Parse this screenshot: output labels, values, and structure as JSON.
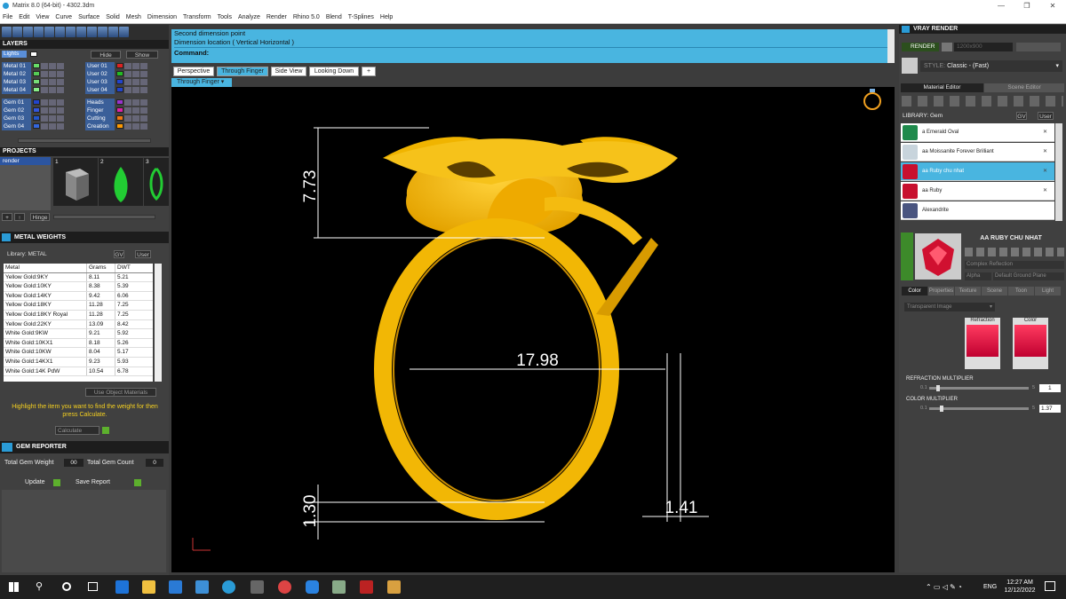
{
  "window": {
    "title": "Matrix 8.0 (64-bit) - 4302.3dm"
  },
  "menu": [
    "File",
    "Edit",
    "View",
    "Curve",
    "Surface",
    "Solid",
    "Mesh",
    "Dimension",
    "Transform",
    "Tools",
    "Analyze",
    "Render",
    "Rhino 5.0",
    "Blend",
    "T-Splines",
    "Help"
  ],
  "layers": {
    "title": "LAYERS",
    "view_mode": "Lights",
    "hide": "Hide",
    "show": "Show",
    "left": [
      {
        "name": "Metal 01",
        "color": "#66dd66"
      },
      {
        "name": "Metal 02",
        "color": "#55cc55"
      },
      {
        "name": "Metal 03",
        "color": "#77dd77"
      },
      {
        "name": "Metal 04",
        "color": "#88ee88"
      },
      {
        "name": "Gem 01",
        "color": "#2244cc"
      },
      {
        "name": "Gem 02",
        "color": "#3355dd"
      },
      {
        "name": "Gem 03",
        "color": "#2255cc"
      },
      {
        "name": "Gem 04",
        "color": "#3366dd"
      }
    ],
    "right": [
      {
        "name": "User 01",
        "color": "#dd2222"
      },
      {
        "name": "User 02",
        "color": "#22bb22"
      },
      {
        "name": "User 03",
        "color": "#2244cc"
      },
      {
        "name": "User 04",
        "color": "#2244cc"
      },
      {
        "name": "Heads",
        "color": "#9933cc"
      },
      {
        "name": "Finger",
        "color": "#dd22aa"
      },
      {
        "name": "Cutting",
        "color": "#ee7711"
      },
      {
        "name": "Creation",
        "color": "#ff9900"
      }
    ]
  },
  "projects": {
    "title": "PROJECTS",
    "item": "render",
    "thumbs": [
      "1",
      "2",
      "3"
    ],
    "hinge": "Hinge"
  },
  "metal_weights": {
    "title": "METAL WEIGHTS",
    "library": "Library: METAL",
    "tab_gv": "GV",
    "tab_user": "User",
    "columns": [
      "Metal",
      "Grams",
      "DWT"
    ],
    "rows": [
      [
        "Yellow Gold:9KY",
        "8.11",
        "5.21"
      ],
      [
        "Yellow Gold:10KY",
        "8.38",
        "5.39"
      ],
      [
        "Yellow Gold:14KY",
        "9.42",
        "6.06"
      ],
      [
        "Yellow Gold:18KY",
        "11.28",
        "7.25"
      ],
      [
        "Yellow Gold:18KY Royal",
        "11.28",
        "7.25"
      ],
      [
        "Yellow Gold:22KY",
        "13.09",
        "8.42"
      ],
      [
        "White Gold:9KW",
        "9.21",
        "5.92"
      ],
      [
        "White Gold:10KX1",
        "8.18",
        "5.26"
      ],
      [
        "White Gold:10KW",
        "8.04",
        "5.17"
      ],
      [
        "White Gold:14KX1",
        "9.23",
        "5.93"
      ],
      [
        "White Gold:14K PdW",
        "10.54",
        "6.78"
      ]
    ],
    "use_object": "Use Object Materials",
    "hint": "Highlight the item you want to find the weight for then press Calculate.",
    "calculate": "Calculate"
  },
  "gem_reporter": {
    "title": "GEM REPORTER",
    "total_weight_label": "Total Gem Weight",
    "total_weight": "00",
    "total_count_label": "Total Gem Count",
    "total_count": "0",
    "update": "Update",
    "save_report": "Save Report"
  },
  "command": {
    "line1": "Second dimension point",
    "line2": "Dimension location ( Vertical  Horizontal )",
    "prompt": "Command:"
  },
  "tabs": [
    "Perspective",
    "Through Finger",
    "Side View",
    "Looking Down",
    "+"
  ],
  "active_tab": "Through Finger",
  "subtab": "Through Finger",
  "dimensions": {
    "top_height": "7.73",
    "inner_diameter": "17.98",
    "band_thickness": "1.30",
    "band_width": "1.41"
  },
  "vray": {
    "title": "VRAY RENDER",
    "render": "RENDER",
    "resolution": "1200x900",
    "style": "Classic - (Fast)",
    "style_label": "STYLE:",
    "tabs": [
      "Material Editor",
      "Scene Editor"
    ],
    "library": "LIBRARY: Gem",
    "tab_gv": "GV",
    "tab_user": "User",
    "materials": [
      {
        "name": "a Emerald Oval",
        "color": "#1f8a4c"
      },
      {
        "name": "aa Moissanite Forever Brilliant",
        "color": "#c8d4dc"
      },
      {
        "name": "aa Ruby chu nhat",
        "color": "#c8102e"
      },
      {
        "name": "aa Ruby",
        "color": "#c8102e"
      },
      {
        "name": "Alexandrite",
        "color": "#4a5580"
      }
    ],
    "preview_title": "AA RUBY CHU NHAT",
    "complex": "Complex Reflection",
    "alpha": "Alpha",
    "ground": "Default Ground Plane",
    "sub_tabs": [
      "Color",
      "Properties",
      "Texture",
      "Scene",
      "Toon",
      "Light"
    ],
    "trans": "Transparent Image",
    "refraction": "Refraction",
    "color": "Color",
    "refr_mult_label": "REFRACTION MULTIPLIER",
    "refr_min": "0.1",
    "refr_max": "5",
    "refr_val": "1",
    "refr_frac": 0.07,
    "col_mult_label": "COLOR MULTIPLIER",
    "col_min": "0.1",
    "col_max": "5",
    "col_val": "1.37",
    "col_frac": 0.11
  },
  "taskbar": {
    "time": "12:27 AM",
    "date": "12/12/2022",
    "lang": "ENG"
  },
  "colors": {
    "accent": "#49b5e0",
    "gold": "#f2b705",
    "ruby": "#c8102e"
  }
}
